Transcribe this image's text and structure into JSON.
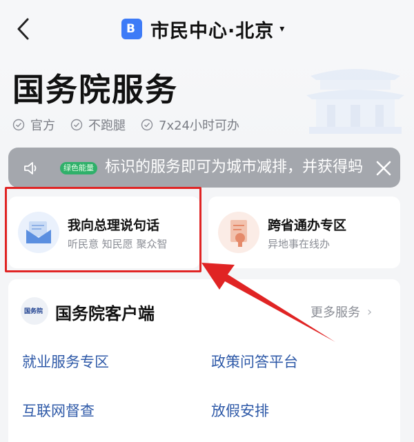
{
  "nav": {
    "title": "市民中心·北京",
    "doc_icon_glyph": "B",
    "caret": "▾"
  },
  "page": {
    "title": "国务院服务"
  },
  "tags": [
    {
      "label": "官方"
    },
    {
      "label": "不跑腿"
    },
    {
      "label": "7x24小时可办"
    }
  ],
  "notice": {
    "badge": "绿色能量",
    "text": "标识的服务即可为城市减排，并获得蚂"
  },
  "cards": [
    {
      "title": "我向总理说句话",
      "subtitle": "听民意 知民愿 聚众智",
      "color": "#5b8fe0"
    },
    {
      "title": "跨省通办专区",
      "subtitle": "异地事在线办",
      "color": "#e58a6a"
    }
  ],
  "client": {
    "logo_text": "国务院",
    "title": "国务院客户端",
    "more_label": "更多服务",
    "services": [
      "就业服务专区",
      "政策问答平台",
      "互联网督查",
      "放假安排"
    ]
  },
  "colors": {
    "accent": "#3d7bf7",
    "link": "#2f5aa8",
    "annotation_red": "#e02424",
    "green_badge": "#2fb06a"
  }
}
